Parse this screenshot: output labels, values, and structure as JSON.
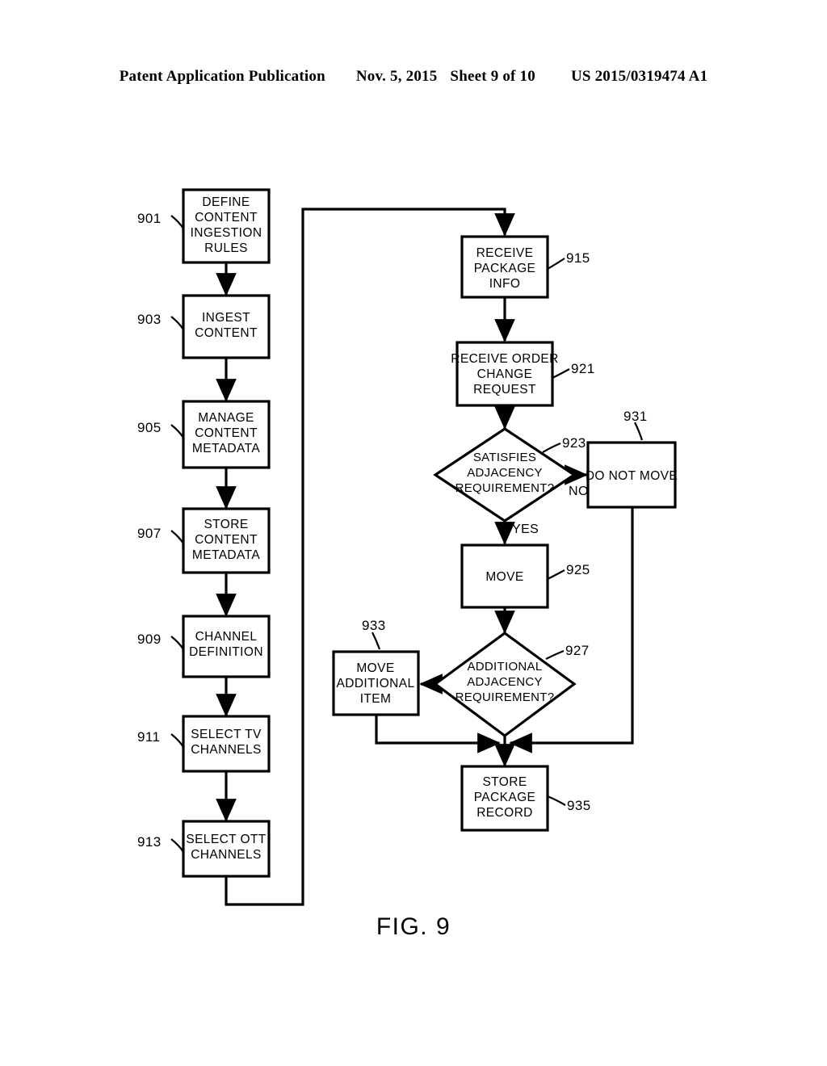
{
  "header": {
    "publication": "Patent Application Publication",
    "date": "Nov. 5, 2015",
    "sheet": "Sheet 9 of 10",
    "patent_number": "US 2015/0319474 A1"
  },
  "figure": {
    "caption": "FIG. 9"
  },
  "nodes": {
    "n901": {
      "ref": "901",
      "lines": [
        "DEFINE",
        "CONTENT",
        "INGESTION",
        "RULES"
      ]
    },
    "n903": {
      "ref": "903",
      "lines": [
        "INGEST",
        "CONTENT"
      ]
    },
    "n905": {
      "ref": "905",
      "lines": [
        "MANAGE",
        "CONTENT",
        "METADATA"
      ]
    },
    "n907": {
      "ref": "907",
      "lines": [
        "STORE",
        "CONTENT",
        "METADATA"
      ]
    },
    "n909": {
      "ref": "909",
      "lines": [
        "CHANNEL",
        "DEFINITION"
      ]
    },
    "n911": {
      "ref": "911",
      "lines": [
        "SELECT TV",
        "CHANNELS"
      ]
    },
    "n913": {
      "ref": "913",
      "lines": [
        "SELECT OTT",
        "CHANNELS"
      ]
    },
    "n915": {
      "ref": "915",
      "lines": [
        "RECEIVE",
        "PACKAGE",
        "INFO"
      ]
    },
    "n921": {
      "ref": "921",
      "lines": [
        "RECEIVE ORDER",
        "CHANGE",
        "REQUEST"
      ]
    },
    "n923": {
      "ref": "923",
      "lines": [
        "SATISFIES",
        "ADJACENCY",
        "REQUIREMENT?"
      ]
    },
    "n925": {
      "ref": "925",
      "lines": [
        "MOVE"
      ]
    },
    "n927": {
      "ref": "927",
      "lines": [
        "ADDITIONAL",
        "ADJACENCY",
        "REQUIREMENT?"
      ]
    },
    "n931": {
      "ref": "931",
      "lines": [
        "DO NOT MOVE"
      ]
    },
    "n933": {
      "ref": "933",
      "lines": [
        "MOVE",
        "ADDITIONAL",
        "ITEM"
      ]
    },
    "n935": {
      "ref": "935",
      "lines": [
        "STORE",
        "PACKAGE",
        "RECORD"
      ]
    }
  },
  "edge_labels": {
    "no": "NO",
    "yes": "YES"
  },
  "colors": {
    "ink": "#000000",
    "paper": "#ffffff"
  }
}
